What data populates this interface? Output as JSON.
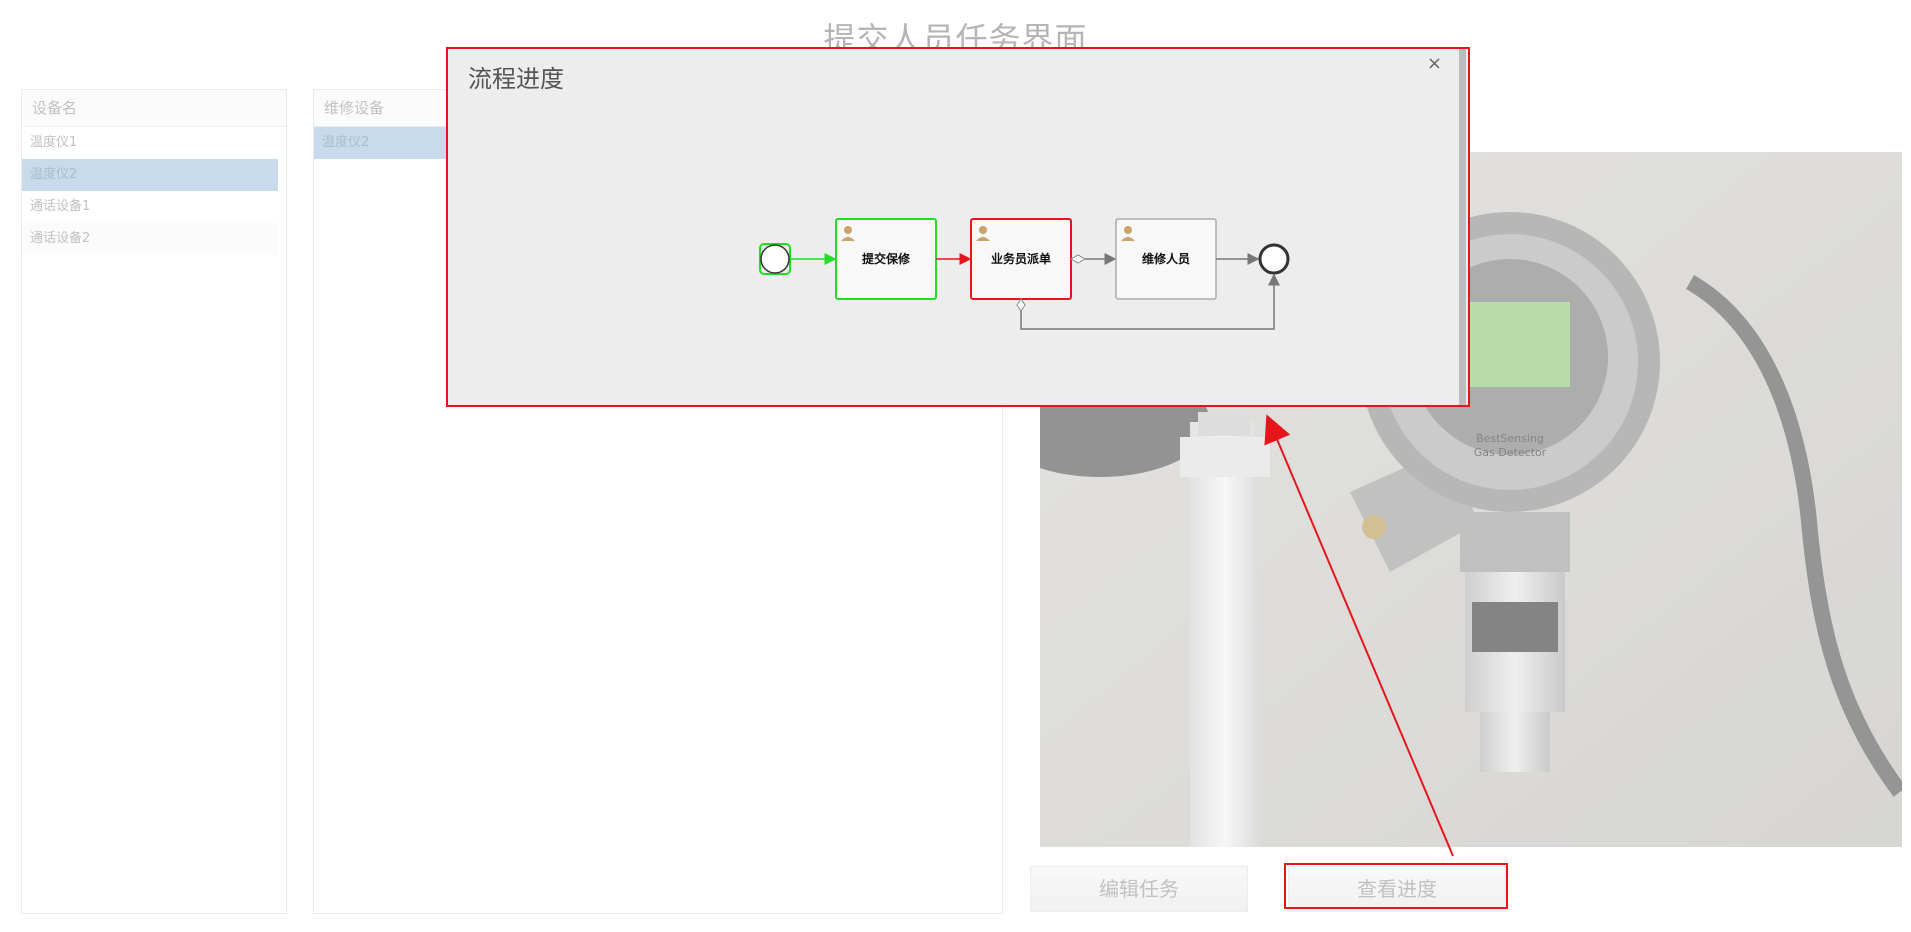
{
  "page": {
    "title": "提交人员任务界面"
  },
  "device_list": {
    "header": "设备名",
    "items": [
      {
        "label": "温度仪1",
        "selected": false
      },
      {
        "label": "温度仪2",
        "selected": true
      },
      {
        "label": "通话设备1",
        "selected": false
      },
      {
        "label": "通话设备2",
        "selected": false
      }
    ]
  },
  "repair_list": {
    "header": "维修设备",
    "items": [
      {
        "label": "温度仪2",
        "selected": true
      }
    ]
  },
  "photo": {
    "label_top": "BestSensing",
    "label_bottom": "Gas Detector"
  },
  "actions": {
    "edit_label": "编辑任务",
    "progress_label": "查看进度"
  },
  "modal": {
    "title": "流程进度",
    "close_label": "×",
    "steps": [
      {
        "label": "提交保修",
        "state": "done",
        "color": "#22dd22"
      },
      {
        "label": "业务员派单",
        "state": "current",
        "color": "#e8141c"
      },
      {
        "label": "维修人员",
        "state": "pending",
        "color": "#aaaaaa"
      }
    ]
  },
  "colors": {
    "highlight": "#e8141c",
    "selected_row": "#b3cde6"
  }
}
